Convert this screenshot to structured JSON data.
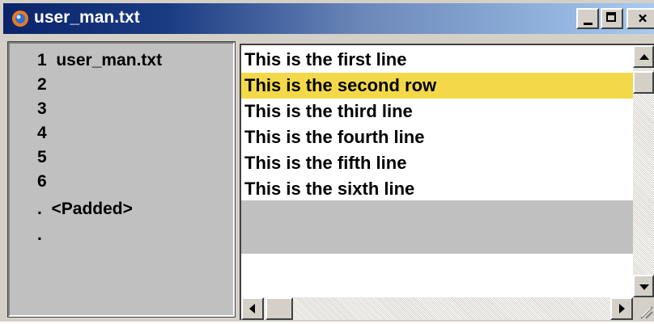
{
  "window": {
    "title": "user_man.txt",
    "icon": "app-circle-icon",
    "controls": {
      "minimize_icon": "minimize-icon",
      "maximize_icon": "maximize-icon",
      "close_label": "×"
    }
  },
  "left_pane": {
    "rows": [
      {
        "text": "1  user_man.txt"
      },
      {
        "text": "2"
      },
      {
        "text": "3"
      },
      {
        "text": "4"
      },
      {
        "text": "5"
      },
      {
        "text": "6"
      },
      {
        "text": ".  <Padded>"
      },
      {
        "text": "."
      }
    ]
  },
  "right_pane": {
    "lines": [
      {
        "text": "This is the first line",
        "selected": false
      },
      {
        "text": "This is the second row",
        "selected": true
      },
      {
        "text": "This is the third line",
        "selected": false
      },
      {
        "text": "This is the fourth line",
        "selected": false
      },
      {
        "text": "This is the fifth line",
        "selected": false
      },
      {
        "text": "This is the sixth line",
        "selected": false
      }
    ]
  },
  "colors": {
    "titlebar_start": "#0a246a",
    "titlebar_end": "#a6caf0",
    "selection": "#f3d94a",
    "pane_gray": "#c0c0c0",
    "chrome": "#d4d0c8"
  },
  "scroll": {
    "vertical_up_icon": "arrow-up-icon",
    "vertical_down_icon": "arrow-down-icon",
    "horizontal_left_icon": "arrow-left-icon",
    "horizontal_right_icon": "arrow-right-icon"
  }
}
